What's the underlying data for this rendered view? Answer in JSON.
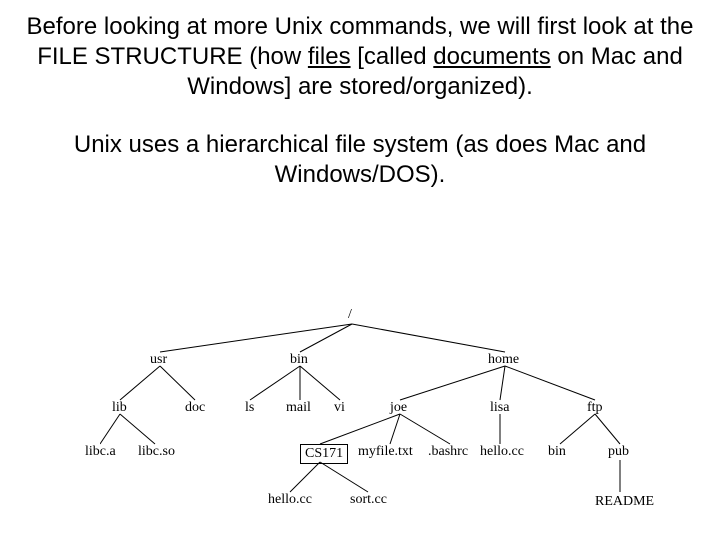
{
  "paragraph1": {
    "t1": "Before looking at more Unix commands, we will first look at the FILE STRUCTURE (how ",
    "u1": "files",
    "t2": " [called ",
    "u2": "documents",
    "t3": " on Mac and Windows] are stored/organized)."
  },
  "paragraph2": "Unix uses a hierarchical file system (as does Mac and Windows/DOS).",
  "tree": {
    "root": "/",
    "usr": "usr",
    "bin": "bin",
    "home": "home",
    "lib": "lib",
    "doc": "doc",
    "ls": "ls",
    "mail": "mail",
    "vi": "vi",
    "joe": "joe",
    "lisa": "lisa",
    "ftp": "ftp",
    "libc_a": "libc.a",
    "libc_so": "libc.so",
    "cs171": "CS171",
    "myfile": "myfile.txt",
    "bashrc": ".bashrc",
    "hello_cc": "hello.cc",
    "bin2": "bin",
    "pub": "pub",
    "hello_cc2": "hello.cc",
    "sort_cc": "sort.cc",
    "readme": "README"
  }
}
